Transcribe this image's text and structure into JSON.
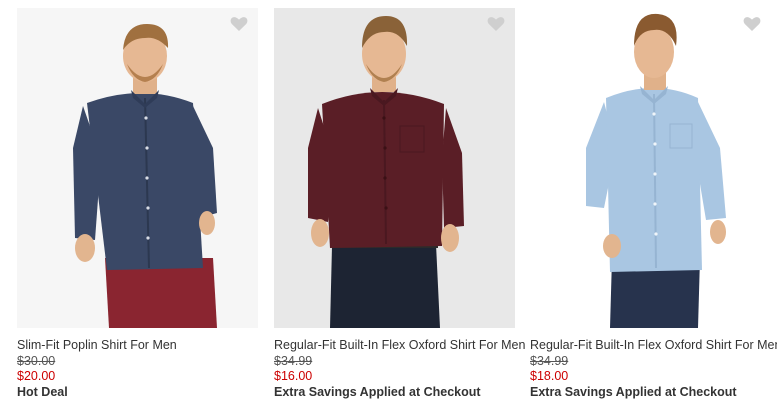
{
  "products": [
    {
      "name": "Slim-Fit Poplin Shirt For Men",
      "original_price": "$30.00",
      "sale_price": "$20.00",
      "promo": "Hot Deal",
      "shirt_color": "#3a4866",
      "pants_color": "#8a2530",
      "background_color": "#f6f6f6"
    },
    {
      "name": "Regular-Fit Built-In Flex Oxford Shirt For Men",
      "original_price": "$34.99",
      "sale_price": "$16.00",
      "promo": "Extra Savings Applied at Checkout",
      "shirt_color": "#5a1e26",
      "pants_color": "#1d2433",
      "background_color": "#e8e8e8"
    },
    {
      "name": "Regular-Fit Built-In Flex Oxford Shirt For Men",
      "original_price": "$34.99",
      "sale_price": "$18.00",
      "promo": "Extra Savings Applied at Checkout",
      "shirt_color": "#a9c6e2",
      "pants_color": "#27334d",
      "background_color": "#ffffff"
    }
  ],
  "icons": {
    "wishlist": "heart-icon"
  },
  "colors": {
    "sale_price": "#cc0000",
    "heart": "#cfcfcf"
  }
}
